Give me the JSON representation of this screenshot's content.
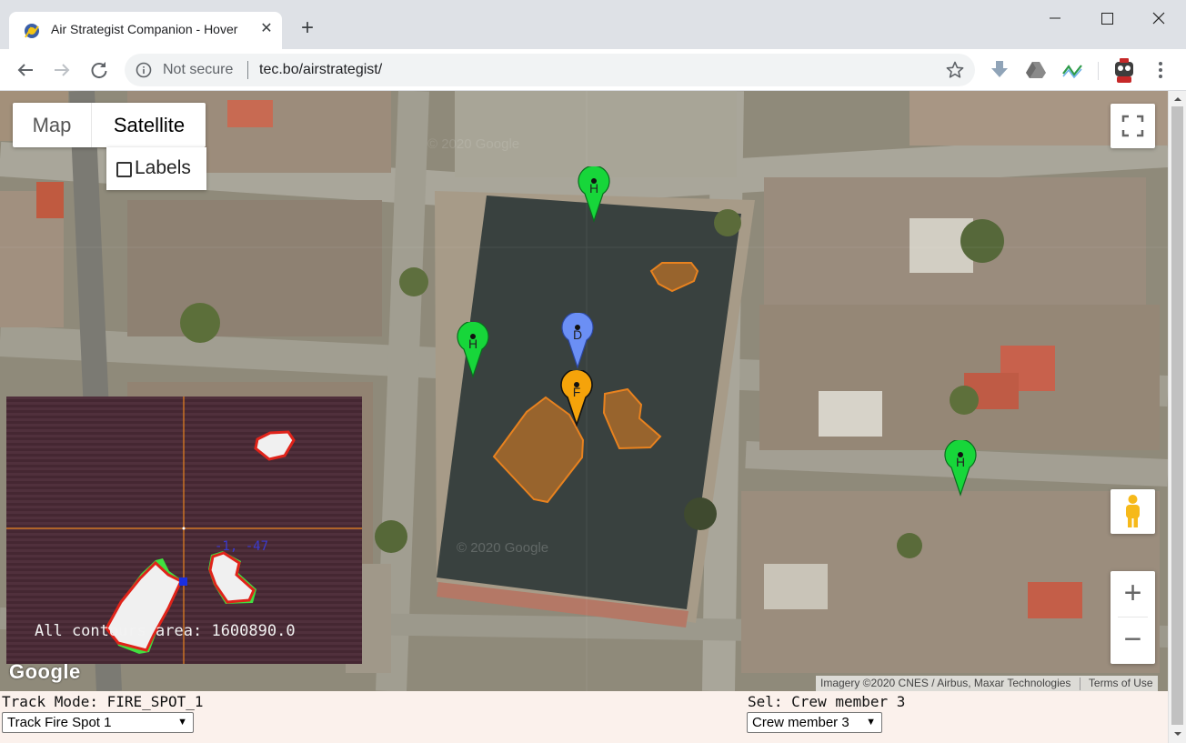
{
  "browser": {
    "tab_title": "Air Strategist Companion - Hover",
    "tab_close": "✕",
    "new_tab": "+",
    "security_label": "Not secure",
    "url": "tec.bo/airstrategist/"
  },
  "icons": {
    "favicon": "gear-with-figure-icon",
    "back": "arrow-left-icon",
    "forward": "arrow-right-icon",
    "reload": "reload-icon",
    "info": "info-circle-icon",
    "star": "star-outline-icon",
    "extensions": [
      "download-arrow-icon",
      "google-drive-icon",
      "wave-icon",
      "robot-avatar-icon"
    ],
    "menu": "kebab-menu-icon"
  },
  "map": {
    "type_buttons": {
      "map": "Map",
      "satellite": "Satellite"
    },
    "labels_checkbox": {
      "label": "Labels",
      "checked": false
    },
    "zoom_in": "+",
    "zoom_out": "−",
    "logo": "Google",
    "attribution": "Imagery ©2020 CNES / Airbus, Maxar Technologies",
    "terms": "Terms of Use",
    "watermark": "© 2020 Google",
    "markers": [
      {
        "label": "H",
        "color": "#17d63a"
      },
      {
        "label": "H",
        "color": "#17d63a"
      },
      {
        "label": "D",
        "color": "#6b8ff5"
      },
      {
        "label": "F",
        "color": "#f5a30a"
      },
      {
        "label": "H",
        "color": "#17d63a"
      }
    ],
    "fire_zone_color": "#e8821f"
  },
  "camera": {
    "contour_area_text": "All contours area: 1600890.0",
    "coord_readout": "-1, -47"
  },
  "bottom_panel": {
    "track_mode_text": "Track Mode: FIRE_SPOT_1",
    "track_select_value": "Track Fire Spot 1",
    "sel_text": "Sel: Crew member 3",
    "crew_select_value": "Crew member 3"
  },
  "colors": {
    "marker_green": "#17d63a",
    "marker_blue": "#6b8ff5",
    "marker_orange": "#f5a30a",
    "bottom_panel_bg": "#fbf1ec"
  }
}
